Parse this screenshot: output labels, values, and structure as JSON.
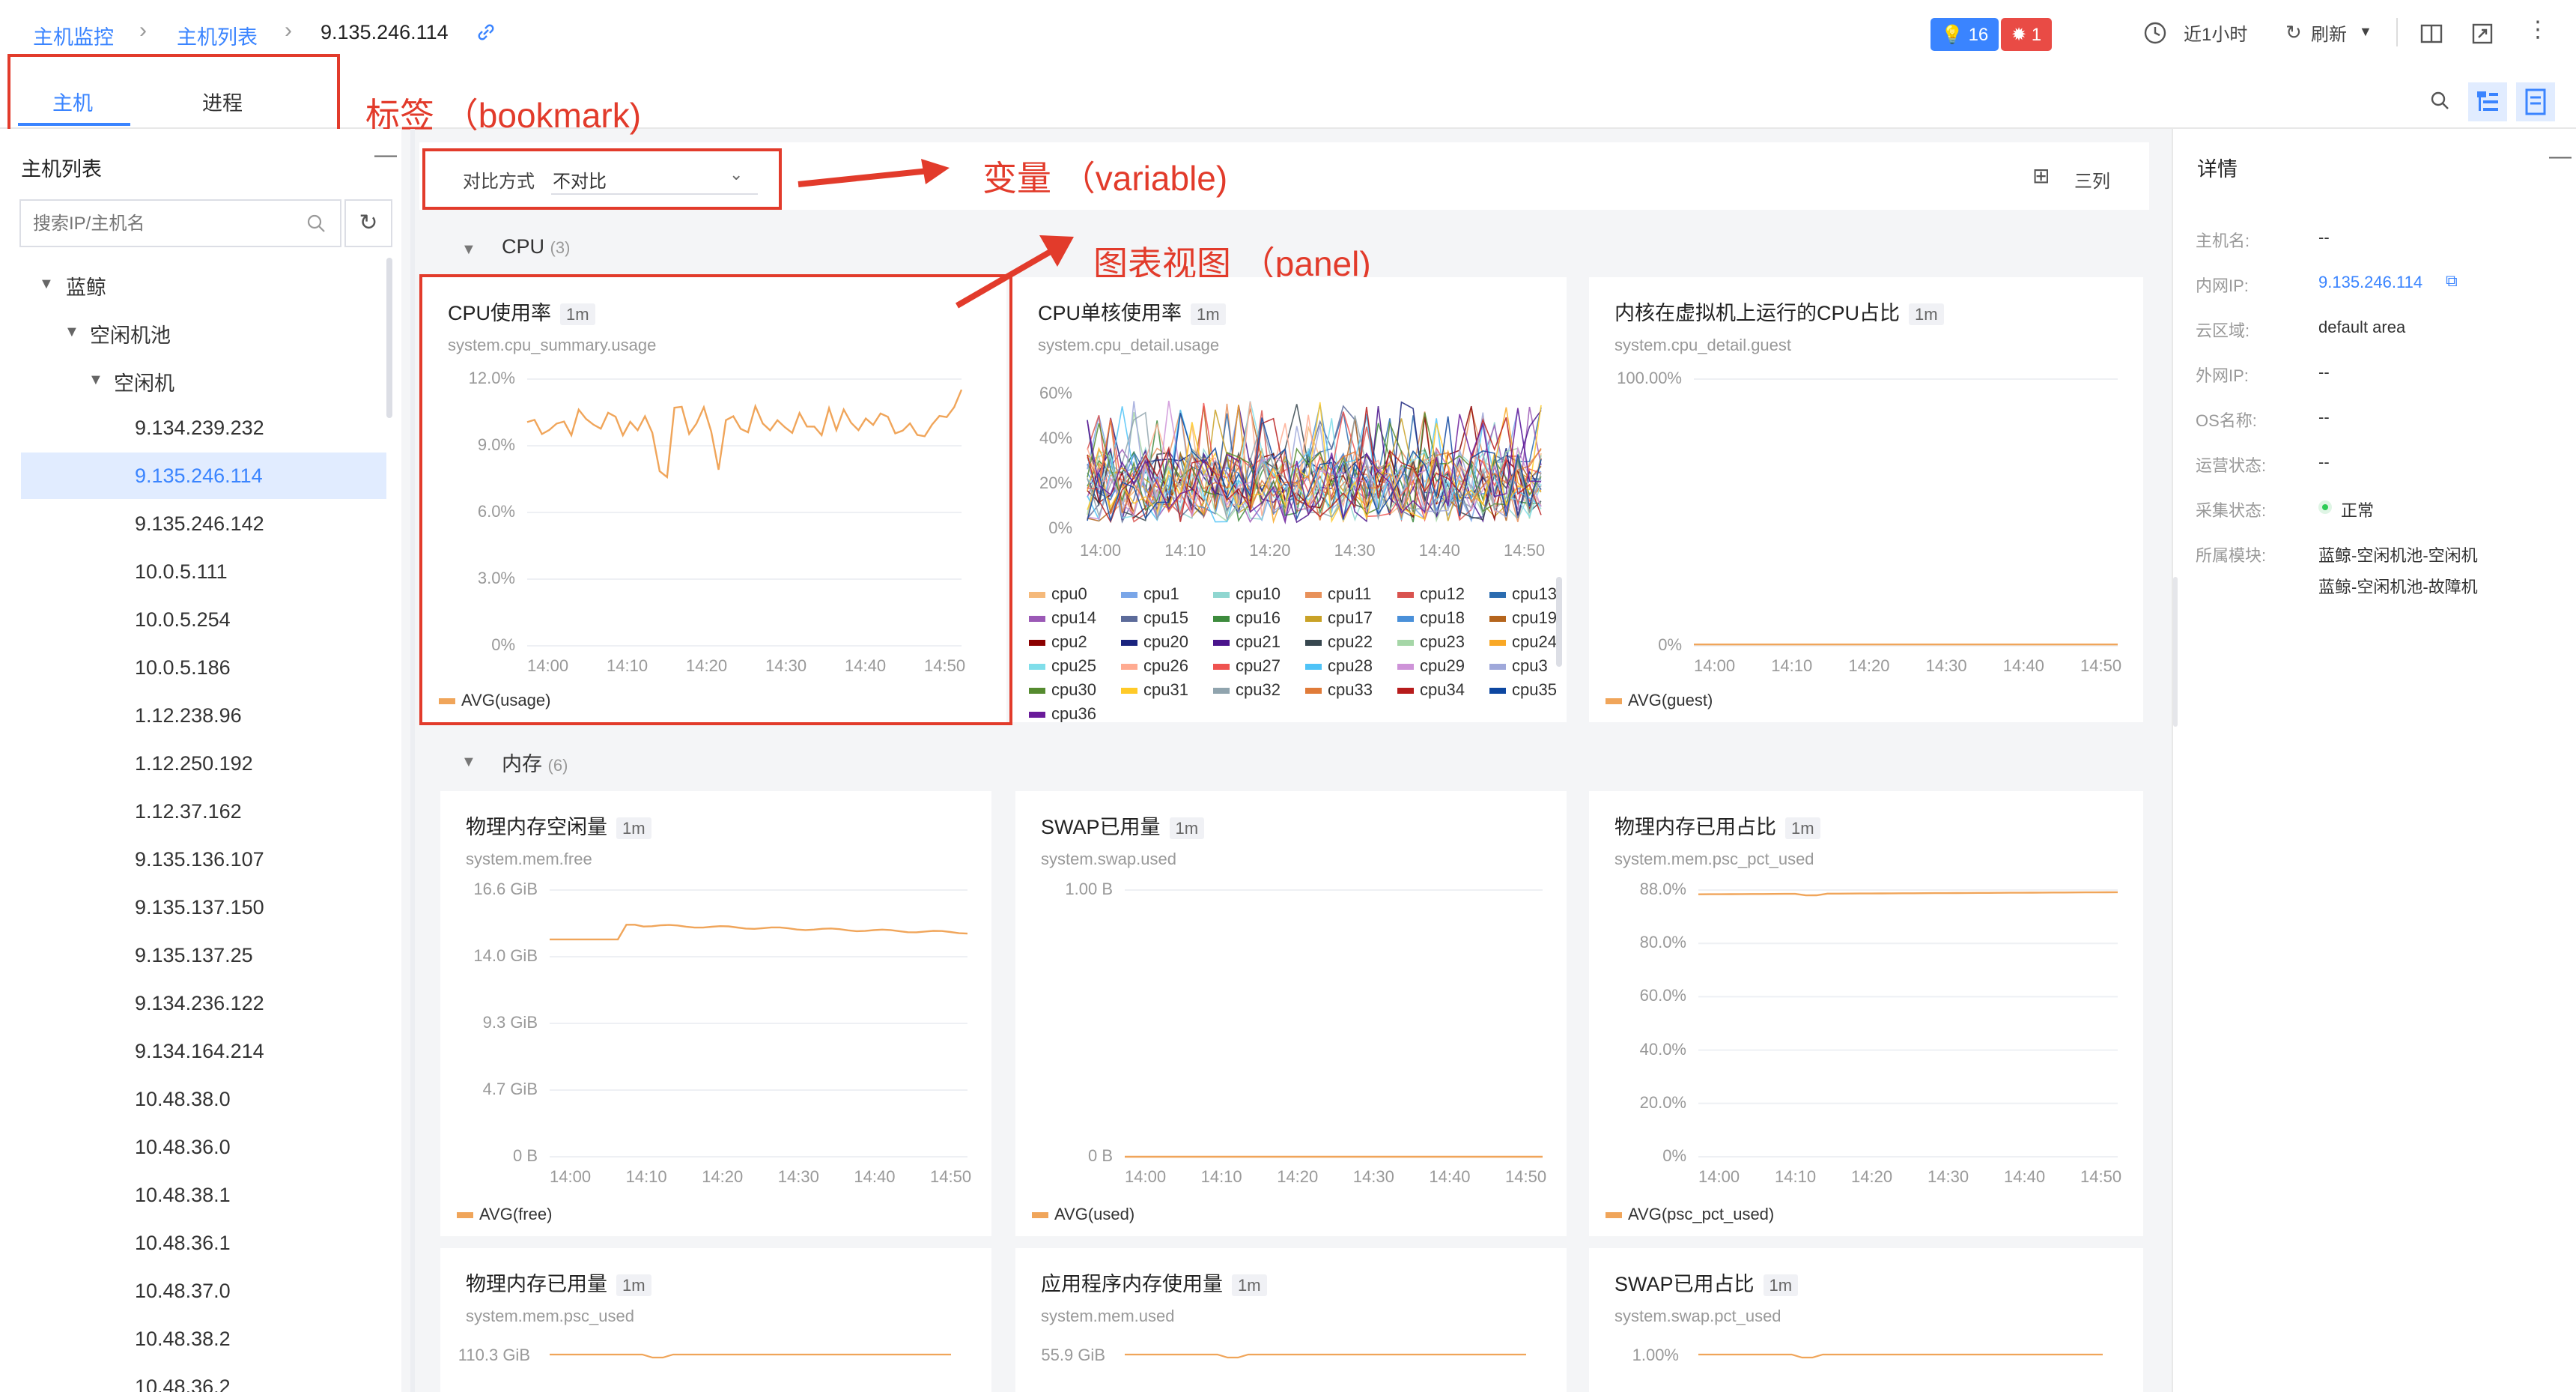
{
  "breadcrumb": {
    "host_monitor": "主机监控",
    "host_list": "主机列表",
    "current": "9.135.246.114"
  },
  "alerts": {
    "blue_count": "16",
    "red_count": "1"
  },
  "toolbar": {
    "time_range": "近1小时",
    "refresh": "刷新"
  },
  "tabs": [
    {
      "label": "主机"
    },
    {
      "label": "进程"
    }
  ],
  "annotations": {
    "bookmark": "标签 （bookmark)",
    "variable": "变量 （variable)",
    "panel": "图表视图 （panel)"
  },
  "sidebar": {
    "title": "主机列表",
    "search_placeholder": "搜索IP/主机名",
    "tree": [
      {
        "label": "蓝鲸",
        "level": 0,
        "expanded": true
      },
      {
        "label": "空闲机池",
        "level": 1,
        "expanded": true
      },
      {
        "label": "空闲机",
        "level": 2,
        "expanded": true
      }
    ],
    "hosts": [
      "9.134.239.232",
      "9.135.246.114",
      "9.135.246.142",
      "10.0.5.111",
      "10.0.5.254",
      "10.0.5.186",
      "1.12.238.96",
      "1.12.250.192",
      "1.12.37.162",
      "9.135.136.107",
      "9.135.137.150",
      "9.135.137.25",
      "9.134.236.122",
      "9.134.164.214",
      "10.48.38.0",
      "10.48.36.0",
      "10.48.38.1",
      "10.48.36.1",
      "10.48.37.0",
      "10.48.38.2",
      "10.48.36.2"
    ],
    "selected_host": "9.135.246.114"
  },
  "variable_bar": {
    "label": "对比方式",
    "value": "不对比",
    "layout_label": "三列"
  },
  "sections": [
    {
      "title": "CPU",
      "count": "(3)"
    },
    {
      "title": "内存",
      "count": "(6)"
    }
  ],
  "panels": {
    "cpu_usage": {
      "title": "CPU使用率",
      "interval": "1m",
      "metric": "system.cpu_summary.usage",
      "yticks": [
        "12.0%",
        "9.0%",
        "6.0%",
        "3.0%",
        "0%"
      ],
      "xticks": [
        "14:00",
        "14:10",
        "14:20",
        "14:30",
        "14:40",
        "14:50"
      ],
      "legend": "AVG(usage)"
    },
    "cpu_core": {
      "title": "CPU单核使用率",
      "interval": "1m",
      "metric": "system.cpu_detail.usage",
      "yticks": [
        "60%",
        "40%",
        "20%",
        "0%"
      ],
      "xticks": [
        "14:00",
        "14:10",
        "14:20",
        "14:30",
        "14:40",
        "14:50"
      ],
      "legend": [
        "cpu0",
        "cpu1",
        "cpu10",
        "cpu11",
        "cpu12",
        "cpu13",
        "cpu14",
        "cpu15",
        "cpu16",
        "cpu17",
        "cpu18",
        "cpu19",
        "cpu2",
        "cpu20",
        "cpu21",
        "cpu22",
        "cpu23",
        "cpu24",
        "cpu25",
        "cpu26",
        "cpu27",
        "cpu28",
        "cpu29",
        "cpu3",
        "cpu30",
        "cpu31",
        "cpu32",
        "cpu33",
        "cpu34",
        "cpu35",
        "cpu36"
      ],
      "legend_colors": [
        "#f5b97a",
        "#7aa6e8",
        "#8fd6d0",
        "#e8915a",
        "#d9534f",
        "#2b6cb0",
        "#9b59b6",
        "#5c6b9a",
        "#3d8b3d",
        "#c9a227",
        "#4a90d9",
        "#b5651d",
        "#8b0000",
        "#1a237e",
        "#4a148c",
        "#37474f",
        "#a5d6a7",
        "#f9a825",
        "#80deea",
        "#ffab91",
        "#ef5350",
        "#4fc3f7",
        "#ce93d8",
        "#9fa8da",
        "#558b2f",
        "#ffca28",
        "#90a4ae",
        "#e07b39",
        "#b71c1c",
        "#0d47a1",
        "#6a1b9a"
      ]
    },
    "cpu_guest": {
      "title": "内核在虚拟机上运行的CPU占比",
      "interval": "1m",
      "metric": "system.cpu_detail.guest",
      "yticks": [
        "100.00%",
        "0%"
      ],
      "xticks": [
        "14:00",
        "14:10",
        "14:20",
        "14:30",
        "14:40",
        "14:50"
      ],
      "legend": "AVG(guest)"
    },
    "mem_free": {
      "title": "物理内存空闲量",
      "interval": "1m",
      "metric": "system.mem.free",
      "yticks": [
        "16.6 GiB",
        "14.0 GiB",
        "9.3 GiB",
        "4.7 GiB",
        "0 B"
      ],
      "xticks": [
        "14:00",
        "14:10",
        "14:20",
        "14:30",
        "14:40",
        "14:50"
      ],
      "legend": "AVG(free)"
    },
    "swap_used": {
      "title": "SWAP已用量",
      "interval": "1m",
      "metric": "system.swap.used",
      "yticks": [
        "1.00 B",
        "0 B"
      ],
      "xticks": [
        "14:00",
        "14:10",
        "14:20",
        "14:30",
        "14:40",
        "14:50"
      ],
      "legend": "AVG(used)"
    },
    "mem_pct": {
      "title": "物理内存已用占比",
      "interval": "1m",
      "metric": "system.mem.psc_pct_used",
      "yticks": [
        "88.0%",
        "80.0%",
        "60.0%",
        "40.0%",
        "20.0%",
        "0%"
      ],
      "xticks": [
        "14:00",
        "14:10",
        "14:20",
        "14:30",
        "14:40",
        "14:50"
      ],
      "legend": "AVG(psc_pct_used)"
    },
    "mem_used": {
      "title": "物理内存已用量",
      "interval": "1m",
      "metric": "system.mem.psc_used",
      "ytop": "110.3 GiB"
    },
    "app_mem": {
      "title": "应用程序内存使用量",
      "interval": "1m",
      "metric": "system.mem.used",
      "ytop": "55.9 GiB"
    },
    "swap_pct": {
      "title": "SWAP已用占比",
      "interval": "1m",
      "metric": "system.swap.pct_used",
      "ytop": "1.00%"
    }
  },
  "detail": {
    "title": "详情",
    "rows": [
      {
        "label": "主机名:",
        "value": "--"
      },
      {
        "label": "内网IP:",
        "value": "9.135.246.114"
      },
      {
        "label": "云区域:",
        "value": "default area"
      },
      {
        "label": "外网IP:",
        "value": "--"
      },
      {
        "label": "OS名称:",
        "value": "--"
      },
      {
        "label": "运营状态:",
        "value": "--"
      },
      {
        "label": "采集状态:",
        "value": "正常"
      },
      {
        "label": "所属模块:",
        "value": "蓝鲸-空闲机池-空闲机"
      }
    ],
    "module_extra": "蓝鲸-空闲机池-故障机"
  },
  "colors": {
    "accent": "#3a84ff",
    "series": "#f0a55a",
    "annotation": "#e23b2b",
    "ok": "#2dcb56"
  }
}
